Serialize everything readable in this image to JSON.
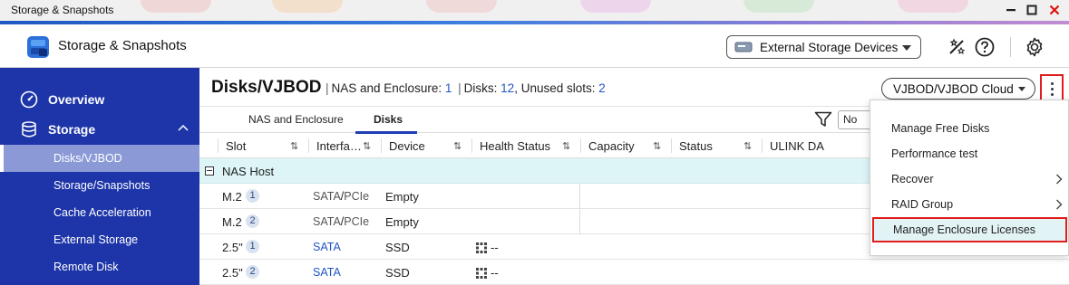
{
  "window": {
    "title": "Storage & Snapshots"
  },
  "header": {
    "app_title": "Storage & Snapshots",
    "external_storage_label": "External Storage Devices"
  },
  "sidebar": {
    "items": [
      {
        "label": "Overview",
        "icon": "dashboard-icon"
      },
      {
        "label": "Storage",
        "icon": "database-icon"
      }
    ],
    "storage_sub": [
      {
        "label": "Disks/VJBOD",
        "active": true
      },
      {
        "label": "Storage/Snapshots"
      },
      {
        "label": "Cache Acceleration"
      },
      {
        "label": "External Storage"
      },
      {
        "label": "Remote Disk"
      }
    ]
  },
  "main": {
    "title": "Disks/VJBOD",
    "summary": {
      "nas_label": "NAS and Enclosure:",
      "nas_value": "1",
      "disks_label": "Disks:",
      "disks_value": "12",
      "unused_label": ", Unused slots:",
      "unused_value": "2"
    },
    "vjbod_button": "VJBOD/VJBOD Cloud",
    "tabs": [
      {
        "label": "NAS and Enclosure"
      },
      {
        "label": "Disks",
        "active": true
      }
    ],
    "filter_value": "No",
    "columns": [
      "Slot",
      "Interfa…",
      "Device",
      "Health Status",
      "Capacity",
      "Status",
      "ULINK DA"
    ],
    "group": "NAS Host",
    "rows": [
      {
        "slot": "M.2",
        "index": "1",
        "iface_a": "SATA",
        "iface_sep": "/",
        "iface_b": "PCIe",
        "device": "Empty",
        "health": ""
      },
      {
        "slot": "M.2",
        "index": "2",
        "iface_a": "SATA",
        "iface_sep": "/",
        "iface_b": "PCIe",
        "device": "Empty",
        "health": ""
      },
      {
        "slot": "2.5\"",
        "index": "1",
        "iface_a": "SATA",
        "device": "SSD",
        "health": "--"
      },
      {
        "slot": "2.5\"",
        "index": "2",
        "iface_a": "SATA",
        "device": "SSD",
        "health": "--"
      }
    ]
  },
  "context_menu": {
    "items": [
      {
        "label": "Manage Free Disks"
      },
      {
        "label": "Performance test"
      },
      {
        "label": "Recover",
        "submenu": true
      },
      {
        "label": "RAID Group",
        "submenu": true
      },
      {
        "label": "Manage Enclosure Licenses",
        "highlighted": true
      }
    ]
  },
  "colors": {
    "sidebar_bg": "#1d35a8",
    "accent_blue": "#1f55c9",
    "highlight_red": "#e01c1c",
    "group_row_bg": "#ddf5f7"
  }
}
